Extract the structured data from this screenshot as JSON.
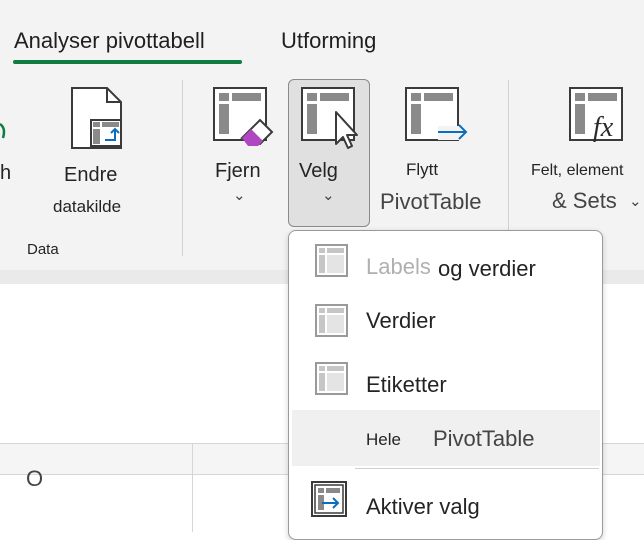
{
  "tabs": {
    "analyze": "Analyser pivottabell",
    "design": "Utforming"
  },
  "ribbon": {
    "partial_left": "h",
    "change_source_line1": "Endre",
    "change_source_line2": "datakilde",
    "group_data": "Data",
    "clear_label": "Fjern",
    "select_label": "Velg",
    "move_line1": "Flytt",
    "move_line2": "PivotTable",
    "fields_line1": "Felt, element",
    "fields_line2": "& Sets",
    "chevron": "⌄"
  },
  "sheet": {
    "column_o": "O"
  },
  "menu": {
    "labels_values_ghost": "Labels",
    "labels_values": "og verdier",
    "values": "Verdier",
    "labels": "Etiketter",
    "entire_prefix": "Hele",
    "entire_pivot": "PivotTable",
    "enable_selection": "Aktiver valg"
  },
  "colors": {
    "accent_green": "#107c41",
    "accent_blue": "#0f6cbd",
    "clear_magenta": "#b146c2"
  }
}
